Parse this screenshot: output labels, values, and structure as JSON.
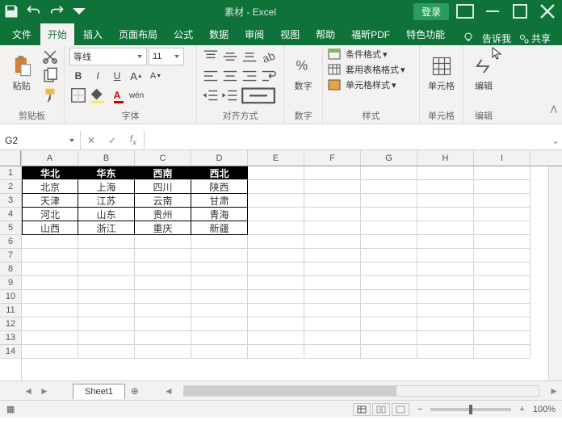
{
  "title": "素材 - Excel",
  "login": "登录",
  "tabs": [
    "文件",
    "开始",
    "插入",
    "页面布局",
    "公式",
    "数据",
    "审阅",
    "视图",
    "帮助",
    "福昕PDF",
    "特色功能"
  ],
  "activeTab": 1,
  "tellMe": "告诉我",
  "share": "共享",
  "font": {
    "name": "等线",
    "size": "11"
  },
  "groups": {
    "clipboard": "剪贴板",
    "font": "字体",
    "align": "对齐方式",
    "number": "数字",
    "styles": "样式",
    "cells": "单元格",
    "editing": "编辑"
  },
  "buttons": {
    "paste": "粘贴",
    "number": "数字",
    "condFmt": "条件格式",
    "tableFmt": "套用表格格式",
    "cellStyle": "单元格样式",
    "cells": "单元格",
    "editing": "编辑"
  },
  "nameBox": "G2",
  "columns": [
    "A",
    "B",
    "C",
    "D",
    "E",
    "F",
    "G",
    "H",
    "I"
  ],
  "rowCount": 14,
  "tableHeaders": [
    "华北",
    "华东",
    "西南",
    "西北"
  ],
  "tableData": [
    [
      "北京",
      "上海",
      "四川",
      "陕西"
    ],
    [
      "天津",
      "江苏",
      "云南",
      "甘肃"
    ],
    [
      "河北",
      "山东",
      "贵州",
      "青海"
    ],
    [
      "山西",
      "浙江",
      "重庆",
      "新疆"
    ]
  ],
  "sheetName": "Sheet1",
  "zoom": "100%"
}
